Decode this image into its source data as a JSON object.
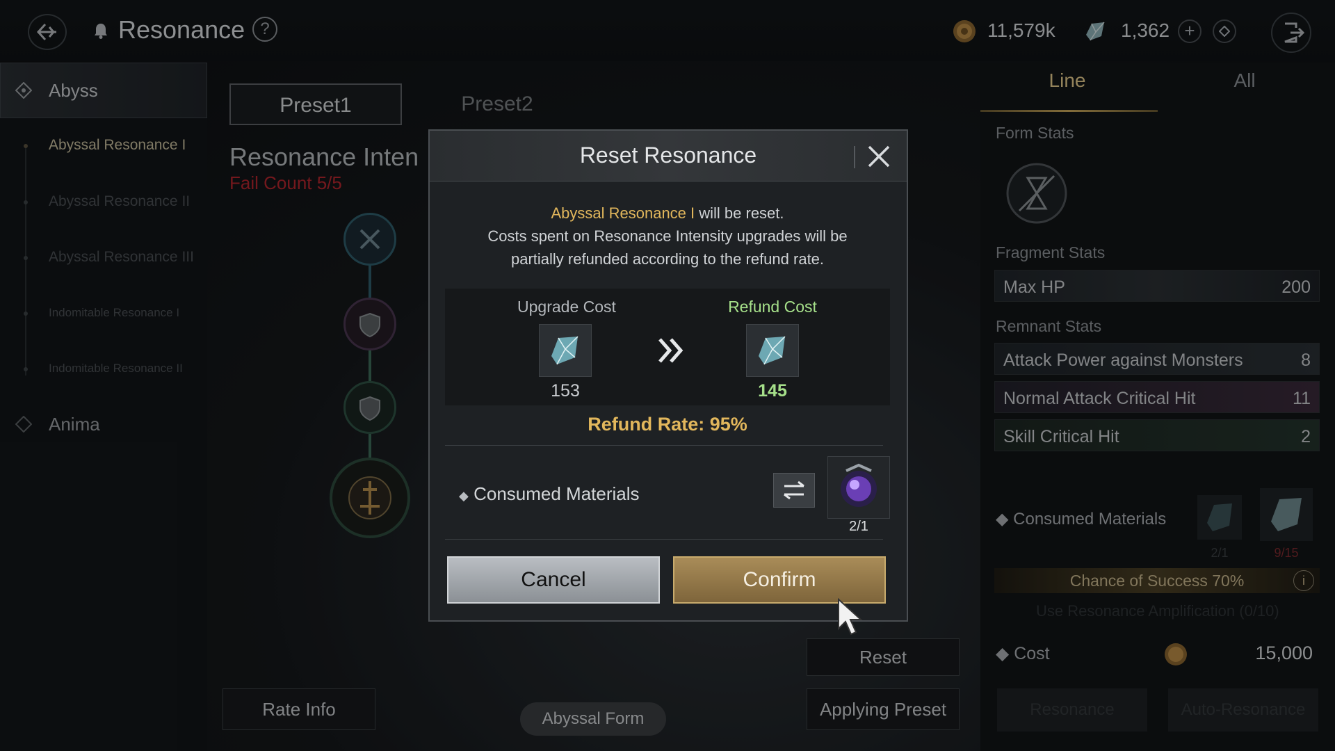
{
  "header": {
    "title": "Resonance",
    "help_label": "?",
    "gold_amount": "11,579k",
    "crystal_amount": "1,362"
  },
  "sidebar": {
    "categories": [
      {
        "label": "Abyss"
      },
      {
        "label": "Anima"
      }
    ],
    "items": [
      {
        "label": "Abyssal Resonance I"
      },
      {
        "label": "Abyssal Resonance II"
      },
      {
        "label": "Abyssal Resonance III"
      },
      {
        "label": "Indomitable Resonance I"
      },
      {
        "label": "Indomitable Resonance II"
      }
    ]
  },
  "main": {
    "presets": [
      "Preset1",
      "Preset2"
    ],
    "heading": "Resonance Inten",
    "fail_count_label": "Fail Count",
    "fail_count_value": "5/5",
    "rate_info": "Rate Info",
    "form_label": "Abyssal Form",
    "reset_label": "Reset",
    "applying_preset": "Applying Preset"
  },
  "right_panel": {
    "tabs": [
      "Line",
      "All"
    ],
    "form_stats": "Form Stats",
    "fragment_stats": "Fragment Stats",
    "remnant_stats": "Remnant Stats",
    "fragment_rows": [
      {
        "label": "Max HP",
        "value": "200"
      }
    ],
    "remnant_rows": [
      {
        "label": "Attack Power against Monsters",
        "value": "8"
      },
      {
        "label": "Normal Attack Critical Hit",
        "value": "11"
      },
      {
        "label": "Skill Critical Hit",
        "value": "2"
      }
    ],
    "consumed_materials": "Consumed Materials",
    "material_counts": [
      "2/1",
      "9/15"
    ],
    "chance_of_success": "Chance of Success 70%",
    "amplification": "Use Resonance Amplification (0/10)",
    "cost_label": "Cost",
    "cost_value": "15,000",
    "resonance_btn": "Resonance",
    "auto_btn": "Auto-Resonance"
  },
  "modal": {
    "title": "Reset Resonance",
    "highlight": "Abyssal Resonance I",
    "line1_rest": " will be reset.",
    "line2": "Costs spent on Resonance Intensity upgrades will be",
    "line3": "partially refunded according to the refund rate.",
    "upgrade_cost_label": "Upgrade Cost",
    "refund_cost_label": "Refund Cost",
    "upgrade_cost": "153",
    "refund_cost": "145",
    "refund_rate": "Refund Rate: 95%",
    "consumed_materials": "Consumed Materials",
    "material_count": "2/1",
    "cancel": "Cancel",
    "confirm": "Confirm"
  },
  "colors": {
    "gold": "#e2b75c",
    "refund_green": "#a6e08a",
    "fail_red": "#b3262d",
    "confirm_bg": "#9a7f4d",
    "cancel_bg": "#a9aeb3"
  }
}
